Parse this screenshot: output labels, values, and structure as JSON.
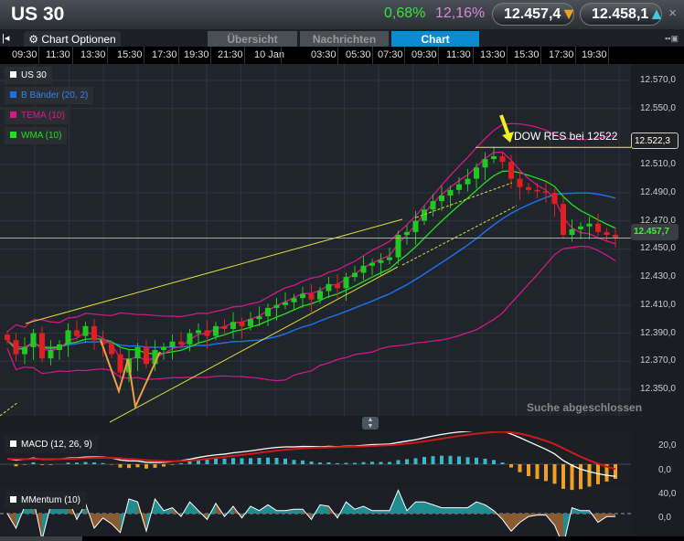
{
  "header": {
    "title": "US 30",
    "change_pct": "0,68%",
    "vol_pct": "12,16%",
    "bid": "12.457,4",
    "ask": "12.458,1",
    "close": "×"
  },
  "toolbar": {
    "collapse": "|◂",
    "chart_options": "Chart Optionen",
    "tabs": [
      "Übersicht",
      "Nachrichten",
      "Chart"
    ],
    "active_tab": "Chart"
  },
  "time_axis": [
    "09:30",
    "11:30",
    "13:30",
    "15:30",
    "17:30",
    "19:30",
    "21:30",
    "10 Jan",
    "03:30",
    "05:30",
    "07:30",
    "09:30",
    "11:30",
    "13:30",
    "15:30",
    "17:30",
    "19:30"
  ],
  "legend": [
    {
      "label": "US 30",
      "color": "#ffffff"
    },
    {
      "label": "B Bänder (20, 2)",
      "color": "#1e6fe8"
    },
    {
      "label": "TEMA (10)",
      "color": "#e0148c"
    },
    {
      "label": "WMA (10)",
      "color": "#1ee01e"
    }
  ],
  "price_axis": [
    "12.570,0",
    "12.550,0",
    "12.510,0",
    "12.490,0",
    "12.470,0",
    "12.450,0",
    "12.430,0",
    "12.410,0",
    "12.390,0",
    "12.370,0",
    "12.350,0"
  ],
  "annotation": "DOW RES bei 12522",
  "resistance_label": "12.522,3",
  "current_price_label": "12.457,7",
  "status": "Suche abgeschlossen",
  "macd": {
    "label": "MACD (12, 26, 9)",
    "axis": [
      "20,0",
      "0,0"
    ]
  },
  "momentum": {
    "label": "MMentum (10)",
    "axis": [
      "40,0",
      "0,0"
    ]
  },
  "chart_data": {
    "type": "candlestick",
    "ylim": [
      12340,
      12580
    ],
    "resistance": 12522.3,
    "current": 12457.7,
    "closes": [
      12385,
      12375,
      12380,
      12390,
      12372,
      12378,
      12382,
      12392,
      12388,
      12395,
      12385,
      12382,
      12375,
      12362,
      12372,
      12380,
      12368,
      12378,
      12380,
      12384,
      12382,
      12390,
      12392,
      12388,
      12395,
      12393,
      12398,
      12395,
      12400,
      12402,
      12408,
      12410,
      12412,
      12415,
      12418,
      12414,
      12420,
      12425,
      12422,
      12430,
      12433,
      12438,
      12440,
      12442,
      12444,
      12460,
      12462,
      12470,
      12478,
      12484,
      12488,
      12492,
      12496,
      12500,
      12508,
      12514,
      12516,
      12512,
      12500,
      12494,
      12492,
      12491,
      12490,
      12482,
      12460,
      12464,
      12466,
      12468,
      12462,
      12460,
      12458
    ]
  }
}
